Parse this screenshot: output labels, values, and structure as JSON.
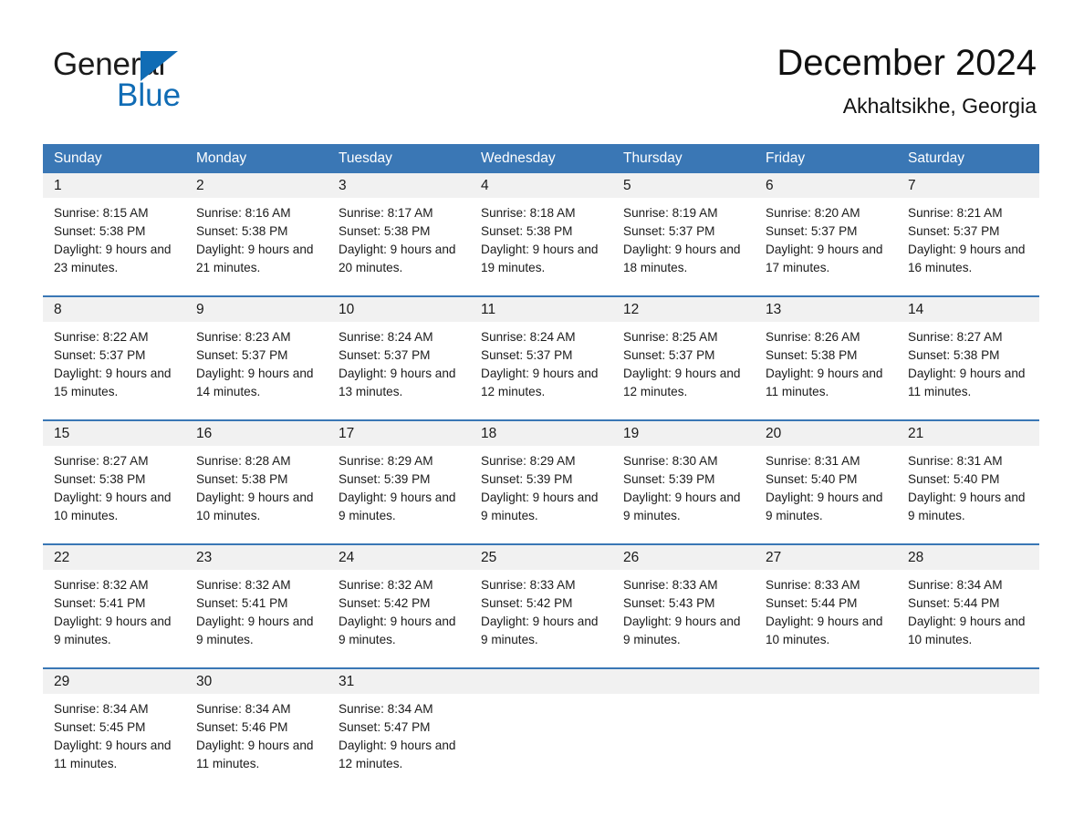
{
  "brand": {
    "line1": "General",
    "line2": "Blue",
    "accent_color": "#106cb5"
  },
  "header": {
    "title": "December 2024",
    "subtitle": "Akhaltsikhe, Georgia"
  },
  "calendar": {
    "header_color": "#3a77b5",
    "weekdays": [
      "Sunday",
      "Monday",
      "Tuesday",
      "Wednesday",
      "Thursday",
      "Friday",
      "Saturday"
    ],
    "weeks": [
      [
        {
          "day": "1",
          "sunrise": "Sunrise: 8:15 AM",
          "sunset": "Sunset: 5:38 PM",
          "daylight": "Daylight: 9 hours and 23 minutes."
        },
        {
          "day": "2",
          "sunrise": "Sunrise: 8:16 AM",
          "sunset": "Sunset: 5:38 PM",
          "daylight": "Daylight: 9 hours and 21 minutes."
        },
        {
          "day": "3",
          "sunrise": "Sunrise: 8:17 AM",
          "sunset": "Sunset: 5:38 PM",
          "daylight": "Daylight: 9 hours and 20 minutes."
        },
        {
          "day": "4",
          "sunrise": "Sunrise: 8:18 AM",
          "sunset": "Sunset: 5:38 PM",
          "daylight": "Daylight: 9 hours and 19 minutes."
        },
        {
          "day": "5",
          "sunrise": "Sunrise: 8:19 AM",
          "sunset": "Sunset: 5:37 PM",
          "daylight": "Daylight: 9 hours and 18 minutes."
        },
        {
          "day": "6",
          "sunrise": "Sunrise: 8:20 AM",
          "sunset": "Sunset: 5:37 PM",
          "daylight": "Daylight: 9 hours and 17 minutes."
        },
        {
          "day": "7",
          "sunrise": "Sunrise: 8:21 AM",
          "sunset": "Sunset: 5:37 PM",
          "daylight": "Daylight: 9 hours and 16 minutes."
        }
      ],
      [
        {
          "day": "8",
          "sunrise": "Sunrise: 8:22 AM",
          "sunset": "Sunset: 5:37 PM",
          "daylight": "Daylight: 9 hours and 15 minutes."
        },
        {
          "day": "9",
          "sunrise": "Sunrise: 8:23 AM",
          "sunset": "Sunset: 5:37 PM",
          "daylight": "Daylight: 9 hours and 14 minutes."
        },
        {
          "day": "10",
          "sunrise": "Sunrise: 8:24 AM",
          "sunset": "Sunset: 5:37 PM",
          "daylight": "Daylight: 9 hours and 13 minutes."
        },
        {
          "day": "11",
          "sunrise": "Sunrise: 8:24 AM",
          "sunset": "Sunset: 5:37 PM",
          "daylight": "Daylight: 9 hours and 12 minutes."
        },
        {
          "day": "12",
          "sunrise": "Sunrise: 8:25 AM",
          "sunset": "Sunset: 5:37 PM",
          "daylight": "Daylight: 9 hours and 12 minutes."
        },
        {
          "day": "13",
          "sunrise": "Sunrise: 8:26 AM",
          "sunset": "Sunset: 5:38 PM",
          "daylight": "Daylight: 9 hours and 11 minutes."
        },
        {
          "day": "14",
          "sunrise": "Sunrise: 8:27 AM",
          "sunset": "Sunset: 5:38 PM",
          "daylight": "Daylight: 9 hours and 11 minutes."
        }
      ],
      [
        {
          "day": "15",
          "sunrise": "Sunrise: 8:27 AM",
          "sunset": "Sunset: 5:38 PM",
          "daylight": "Daylight: 9 hours and 10 minutes."
        },
        {
          "day": "16",
          "sunrise": "Sunrise: 8:28 AM",
          "sunset": "Sunset: 5:38 PM",
          "daylight": "Daylight: 9 hours and 10 minutes."
        },
        {
          "day": "17",
          "sunrise": "Sunrise: 8:29 AM",
          "sunset": "Sunset: 5:39 PM",
          "daylight": "Daylight: 9 hours and 9 minutes."
        },
        {
          "day": "18",
          "sunrise": "Sunrise: 8:29 AM",
          "sunset": "Sunset: 5:39 PM",
          "daylight": "Daylight: 9 hours and 9 minutes."
        },
        {
          "day": "19",
          "sunrise": "Sunrise: 8:30 AM",
          "sunset": "Sunset: 5:39 PM",
          "daylight": "Daylight: 9 hours and 9 minutes."
        },
        {
          "day": "20",
          "sunrise": "Sunrise: 8:31 AM",
          "sunset": "Sunset: 5:40 PM",
          "daylight": "Daylight: 9 hours and 9 minutes."
        },
        {
          "day": "21",
          "sunrise": "Sunrise: 8:31 AM",
          "sunset": "Sunset: 5:40 PM",
          "daylight": "Daylight: 9 hours and 9 minutes."
        }
      ],
      [
        {
          "day": "22",
          "sunrise": "Sunrise: 8:32 AM",
          "sunset": "Sunset: 5:41 PM",
          "daylight": "Daylight: 9 hours and 9 minutes."
        },
        {
          "day": "23",
          "sunrise": "Sunrise: 8:32 AM",
          "sunset": "Sunset: 5:41 PM",
          "daylight": "Daylight: 9 hours and 9 minutes."
        },
        {
          "day": "24",
          "sunrise": "Sunrise: 8:32 AM",
          "sunset": "Sunset: 5:42 PM",
          "daylight": "Daylight: 9 hours and 9 minutes."
        },
        {
          "day": "25",
          "sunrise": "Sunrise: 8:33 AM",
          "sunset": "Sunset: 5:42 PM",
          "daylight": "Daylight: 9 hours and 9 minutes."
        },
        {
          "day": "26",
          "sunrise": "Sunrise: 8:33 AM",
          "sunset": "Sunset: 5:43 PM",
          "daylight": "Daylight: 9 hours and 9 minutes."
        },
        {
          "day": "27",
          "sunrise": "Sunrise: 8:33 AM",
          "sunset": "Sunset: 5:44 PM",
          "daylight": "Daylight: 9 hours and 10 minutes."
        },
        {
          "day": "28",
          "sunrise": "Sunrise: 8:34 AM",
          "sunset": "Sunset: 5:44 PM",
          "daylight": "Daylight: 9 hours and 10 minutes."
        }
      ],
      [
        {
          "day": "29",
          "sunrise": "Sunrise: 8:34 AM",
          "sunset": "Sunset: 5:45 PM",
          "daylight": "Daylight: 9 hours and 11 minutes."
        },
        {
          "day": "30",
          "sunrise": "Sunrise: 8:34 AM",
          "sunset": "Sunset: 5:46 PM",
          "daylight": "Daylight: 9 hours and 11 minutes."
        },
        {
          "day": "31",
          "sunrise": "Sunrise: 8:34 AM",
          "sunset": "Sunset: 5:47 PM",
          "daylight": "Daylight: 9 hours and 12 minutes."
        },
        {
          "day": "",
          "sunrise": "",
          "sunset": "",
          "daylight": ""
        },
        {
          "day": "",
          "sunrise": "",
          "sunset": "",
          "daylight": ""
        },
        {
          "day": "",
          "sunrise": "",
          "sunset": "",
          "daylight": ""
        },
        {
          "day": "",
          "sunrise": "",
          "sunset": "",
          "daylight": ""
        }
      ]
    ]
  }
}
